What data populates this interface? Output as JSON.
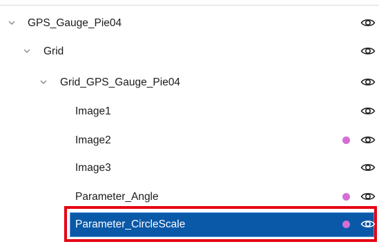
{
  "tree": {
    "items": [
      {
        "label": "GPS_Gauge_Pie04",
        "expanded": true,
        "has_dot": false,
        "selected": false
      },
      {
        "label": "Grid",
        "expanded": true,
        "has_dot": false,
        "selected": false
      },
      {
        "label": "Grid_GPS_Gauge_Pie04",
        "expanded": true,
        "has_dot": false,
        "selected": false
      },
      {
        "label": "Image1",
        "expanded": null,
        "has_dot": false,
        "selected": false
      },
      {
        "label": "Image2",
        "expanded": null,
        "has_dot": true,
        "selected": false
      },
      {
        "label": "Image3",
        "expanded": null,
        "has_dot": false,
        "selected": false
      },
      {
        "label": "Parameter_Angle",
        "expanded": null,
        "has_dot": true,
        "selected": false
      },
      {
        "label": "Parameter_CircleScale",
        "expanded": null,
        "has_dot": true,
        "selected": true
      }
    ],
    "visibility_icon": "eye-icon",
    "expand_icon": "chevron-down-icon"
  },
  "colors": {
    "text": "#1b1b1b",
    "selected_text": "#ffffff",
    "selected_bg": "#0a58a8",
    "dot": "#d46ed6",
    "highlight_frame": "#e60012",
    "chevron": "#8a8a8a"
  }
}
